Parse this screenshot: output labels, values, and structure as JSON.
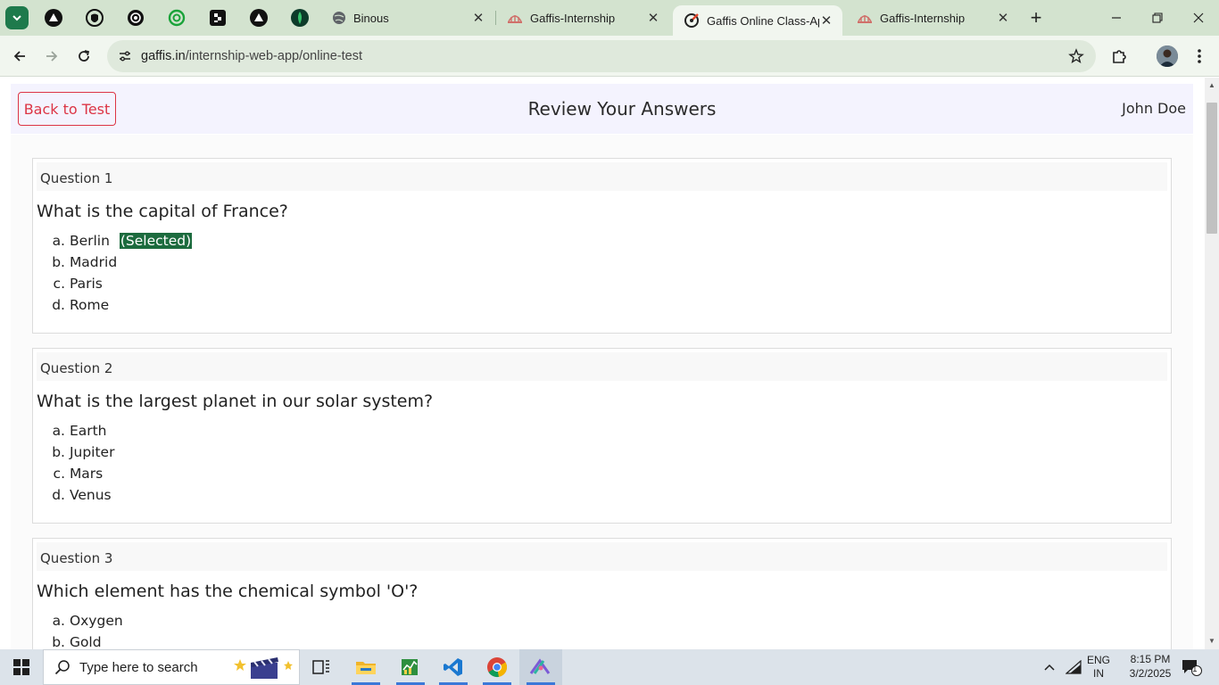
{
  "browser": {
    "tabs": [
      {
        "title": "Binous"
      },
      {
        "title": "Gaffis-Internship"
      },
      {
        "title": "Gaffis Online Class-App"
      },
      {
        "title": "Gaffis-Internship"
      }
    ],
    "active_tab_index": 2,
    "url_domain": "gaffis.in",
    "url_path": "/internship-web-app/online-test"
  },
  "page": {
    "back_button": "Back to Test",
    "title": "Review Your Answers",
    "user_name": "John Doe",
    "selected_tag": "(Selected)",
    "questions": [
      {
        "label": "Question 1",
        "text": "What is the capital of France?",
        "options": [
          {
            "letter": "a.",
            "text": "Berlin",
            "selected": true
          },
          {
            "letter": "b.",
            "text": "Madrid",
            "selected": false
          },
          {
            "letter": "c.",
            "text": "Paris",
            "selected": false
          },
          {
            "letter": "d.",
            "text": "Rome",
            "selected": false
          }
        ]
      },
      {
        "label": "Question 2",
        "text": "What is the largest planet in our solar system?",
        "options": [
          {
            "letter": "a.",
            "text": "Earth",
            "selected": false
          },
          {
            "letter": "b.",
            "text": "Jupiter",
            "selected": false
          },
          {
            "letter": "c.",
            "text": "Mars",
            "selected": false
          },
          {
            "letter": "d.",
            "text": "Venus",
            "selected": false
          }
        ]
      },
      {
        "label": "Question 3",
        "text": "Which element has the chemical symbol 'O'?",
        "options": [
          {
            "letter": "a.",
            "text": "Oxygen",
            "selected": false
          },
          {
            "letter": "b.",
            "text": "Gold",
            "selected": false
          }
        ]
      }
    ]
  },
  "taskbar": {
    "search_placeholder": "Type here to search",
    "lang_top": "ENG",
    "lang_bottom": "IN",
    "time": "8:15 PM",
    "date": "3/2/2025",
    "notification_count": "1"
  },
  "colors": {
    "accent_green": "#1c6b3e",
    "back_button_red": "#dc3545",
    "tabstrip": "#d3e3cf"
  }
}
